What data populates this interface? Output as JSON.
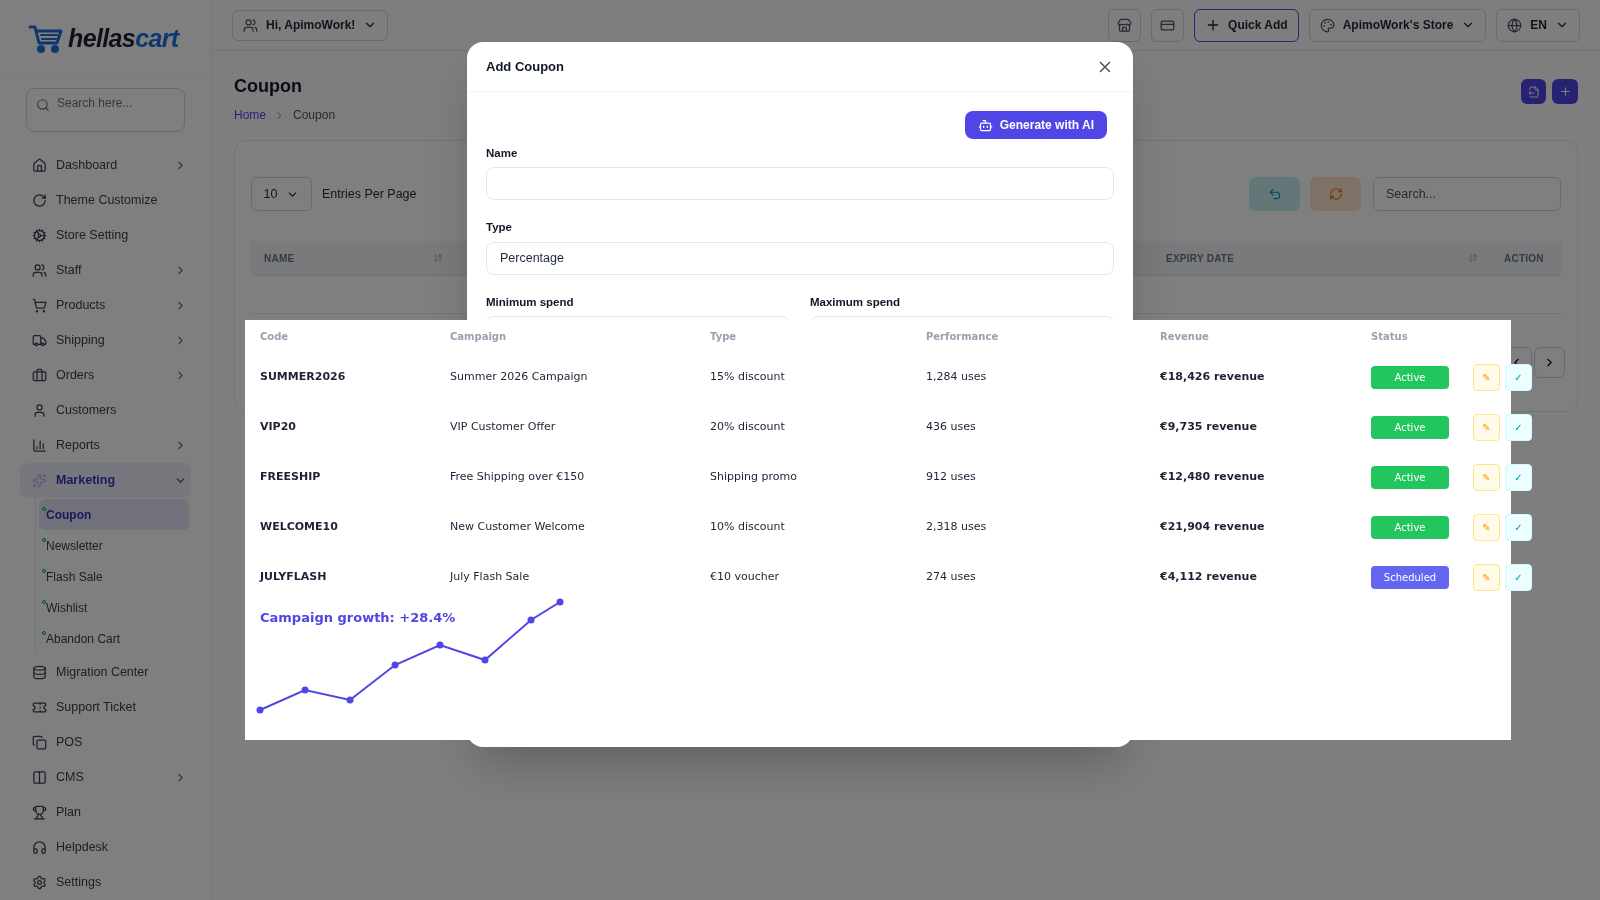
{
  "sidebar": {
    "logo": {
      "part_1": "hellas",
      "part_2": "cart"
    },
    "search": {
      "placeholder": "Search here..."
    },
    "items": [
      {
        "label": "Dashboard",
        "expanded": false,
        "selected": false
      },
      {
        "label": "Theme Customize",
        "selected": false
      },
      {
        "label": "Store Setting",
        "selected": false
      },
      {
        "label": "Staff",
        "expanded": false,
        "selected": false
      },
      {
        "label": "Products",
        "expanded": false,
        "selected": false
      },
      {
        "label": "Shipping",
        "expanded": false,
        "selected": false
      },
      {
        "label": "Orders",
        "expanded": false,
        "selected": false
      },
      {
        "label": "Customers",
        "selected": false
      },
      {
        "label": "Reports",
        "expanded": false,
        "selected": false
      },
      {
        "label": "Marketing",
        "expanded": true,
        "selected": true,
        "children": [
          {
            "label": "Coupon",
            "selected": true
          },
          {
            "label": "Newsletter",
            "selected": false
          },
          {
            "label": "Flash Sale",
            "selected": false
          },
          {
            "label": "Wishlist",
            "selected": false
          },
          {
            "label": "Abandon Cart",
            "selected": false
          }
        ]
      },
      {
        "label": "Migration Center",
        "selected": false
      },
      {
        "label": "Support Ticket",
        "selected": false
      },
      {
        "label": "POS",
        "selected": false
      },
      {
        "label": "CMS",
        "expanded": false,
        "selected": false
      },
      {
        "label": "Plan",
        "selected": false
      },
      {
        "label": "Helpdesk",
        "selected": false
      },
      {
        "label": "Settings",
        "selected": false
      }
    ]
  },
  "topbar": {
    "user_menu": "Hi, ApimoWork!",
    "quick_add": "Quick Add",
    "store_menu": "ApimoWork's Store",
    "language": "EN"
  },
  "page": {
    "title": "Coupon",
    "breadcrumb": [
      "Home",
      "Coupon"
    ],
    "entries": {
      "value": "10",
      "label": "Entries Per Page"
    },
    "search": {
      "placeholder": "Search..."
    },
    "table": {
      "columns": [
        {
          "label": "NAME",
          "sortable": true
        },
        {
          "label": "EXPIRY DATE",
          "sortable": true
        },
        {
          "label": "ACTION",
          "sortable": false
        }
      ]
    }
  },
  "modal": {
    "title": "Add Coupon",
    "generate_button": "Generate with AI",
    "fields": [
      {
        "label": "Name"
      },
      {
        "label": "Type",
        "value": "Percentage"
      }
    ],
    "spend_fields": [
      {
        "label": "Minimum spend"
      },
      {
        "label": "Maximum spend"
      }
    ]
  },
  "campaign_table": {
    "columns": [
      "Code",
      "Campaign",
      "Type",
      "Performance",
      "Revenue",
      "Status"
    ],
    "rows": [
      {
        "code": "SUMMER2026",
        "campaign": "Summer 2026 Campaign",
        "type": "15% discount",
        "performance": "1,284 uses",
        "revenue": "€18,426 revenue",
        "status": {
          "label": "Active",
          "color": "#22c55e"
        },
        "actions": [
          "✎",
          "✓"
        ]
      },
      {
        "code": "VIP20",
        "campaign": "VIP Customer Offer",
        "type": "20% discount",
        "performance": "436 uses",
        "revenue": "€9,735 revenue",
        "status": {
          "label": "Active",
          "color": "#22c55e"
        },
        "actions": [
          "✎",
          "✓"
        ]
      },
      {
        "code": "FREESHIP",
        "campaign": "Free Shipping over €150",
        "type": "Shipping promo",
        "performance": "912 uses",
        "revenue": "€12,480 revenue",
        "status": {
          "label": "Active",
          "color": "#22c55e"
        },
        "actions": [
          "✎",
          "✓"
        ]
      },
      {
        "code": "WELCOME10",
        "campaign": "New Customer Welcome",
        "type": "10% discount",
        "performance": "2,318 uses",
        "revenue": "€21,904 revenue",
        "status": {
          "label": "Active",
          "color": "#22c55e"
        },
        "actions": [
          "✎",
          "✓"
        ]
      },
      {
        "code": "JULYFLASH",
        "campaign": "July Flash Sale",
        "type": "€10 voucher",
        "performance": "274 uses",
        "revenue": "€4,112 revenue",
        "status": {
          "label": "Scheduled",
          "color": "#6366f1"
        },
        "actions": [
          "✎",
          "✓"
        ]
      }
    ],
    "growth": {
      "title": "Campaign growth: +28.4%"
    }
  }
}
